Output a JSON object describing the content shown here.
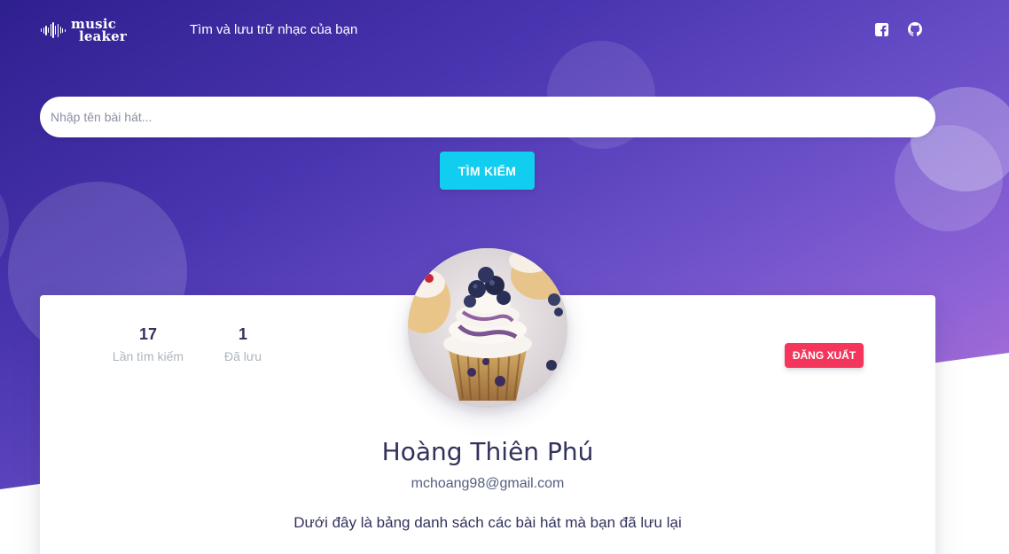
{
  "navbar": {
    "logo_line1": "music",
    "logo_line2": "leaker",
    "tagline": "Tìm và lưu trữ nhạc của bạn",
    "social_facebook_icon": "facebook-icon",
    "social_github_icon": "github-icon"
  },
  "search": {
    "placeholder": "Nhập tên bài hát...",
    "value": "",
    "button_label": "TÌM KIẾM"
  },
  "profile": {
    "stats": [
      {
        "value": "17",
        "label": "Lần tìm kiếm"
      },
      {
        "value": "1",
        "label": "Đã lưu"
      }
    ],
    "logout_label": "ĐĂNG XUẤT",
    "name": "Hoàng Thiên Phú",
    "email": "mchoang98@gmail.com",
    "description": "Dưới đây là bảng danh sách các bài hát mà bạn đã lưu lại"
  },
  "colors": {
    "search_button": "#11cdef",
    "logout_button": "#f5365c",
    "gradient_start": "#2e1f8f",
    "gradient_end": "#c77cd6"
  }
}
